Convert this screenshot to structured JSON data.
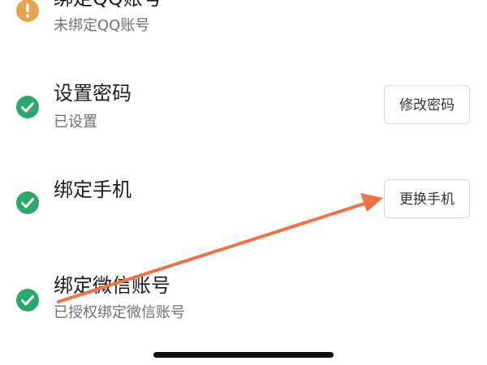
{
  "colors": {
    "warning": "#e8a34a",
    "success": "#2aa86a",
    "annotation_arrow": "#f07241"
  },
  "rows": [
    {
      "title": "绑定QQ账号",
      "subtitle": "未绑定QQ账号",
      "status_icon": "warning-icon"
    },
    {
      "title": "设置密码",
      "subtitle": "已设置",
      "status_icon": "check-icon",
      "button_label": "修改密码"
    },
    {
      "title": "绑定手机",
      "status_icon": "check-icon",
      "button_label": "更换手机"
    },
    {
      "title": "绑定微信账号",
      "subtitle": "已授权绑定微信账号",
      "status_icon": "check-icon"
    }
  ]
}
